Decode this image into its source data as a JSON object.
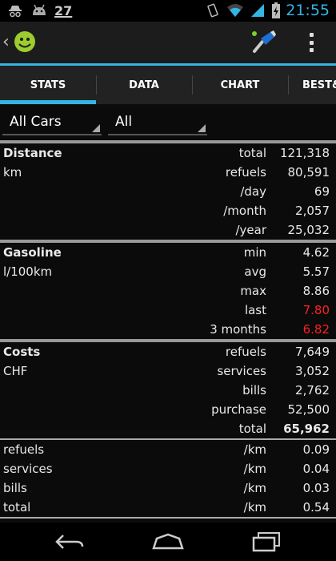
{
  "status_bar": {
    "notification_count": "27",
    "time": "21:55",
    "icons": [
      "incognito-icon",
      "android-icon",
      "vibrate-icon",
      "wifi-icon",
      "signal-icon",
      "battery-charging-icon"
    ]
  },
  "action_bar": {
    "icons": [
      "back-caret-icon",
      "app-logo-icon",
      "fuel-pump-icon",
      "overflow-menu-icon"
    ]
  },
  "tabs": [
    {
      "label": "STATS",
      "active": true
    },
    {
      "label": "DATA",
      "active": false
    },
    {
      "label": "CHART",
      "active": false
    },
    {
      "label": "BEST&",
      "active": false
    }
  ],
  "filters": {
    "car": "All Cars",
    "period": "All"
  },
  "sections": {
    "distance": {
      "title": "Distance",
      "unit": "km",
      "rows": [
        {
          "metric": "total",
          "value": "121,318"
        },
        {
          "metric": "refuels",
          "value": "80,591"
        },
        {
          "metric": "/day",
          "value": "69"
        },
        {
          "metric": "/month",
          "value": "2,057"
        },
        {
          "metric": "/year",
          "value": "25,032"
        }
      ]
    },
    "gasoline": {
      "title": "Gasoline",
      "unit": "l/100km",
      "rows": [
        {
          "metric": "min",
          "value": "4.62"
        },
        {
          "metric": "avg",
          "value": "5.57"
        },
        {
          "metric": "max",
          "value": "8.86"
        },
        {
          "metric": "last",
          "value": "7.80"
        },
        {
          "metric": "3 months",
          "value": "6.82"
        }
      ]
    },
    "costs": {
      "title": "Costs",
      "unit": "CHF",
      "rows": [
        {
          "metric": "refuels",
          "value": "7,649"
        },
        {
          "metric": "services",
          "value": "3,052"
        },
        {
          "metric": "bills",
          "value": "2,762"
        },
        {
          "metric": "purchase",
          "value": "52,500"
        },
        {
          "metric": "total",
          "value": "65,962"
        }
      ]
    },
    "per_km": {
      "rows": [
        {
          "label": "refuels",
          "metric": "/km",
          "value": "0.09"
        },
        {
          "label": "services",
          "metric": "/km",
          "value": "0.04"
        },
        {
          "label": "bills",
          "metric": "/km",
          "value": "0.03"
        },
        {
          "label": "total",
          "metric": "/km",
          "value": "0.54"
        }
      ]
    }
  },
  "colors": {
    "accent": "#33b5e5",
    "warning_value": "#ff2020"
  },
  "nav_bar": {
    "icons": [
      "back-icon",
      "home-icon",
      "recent-apps-icon"
    ]
  }
}
